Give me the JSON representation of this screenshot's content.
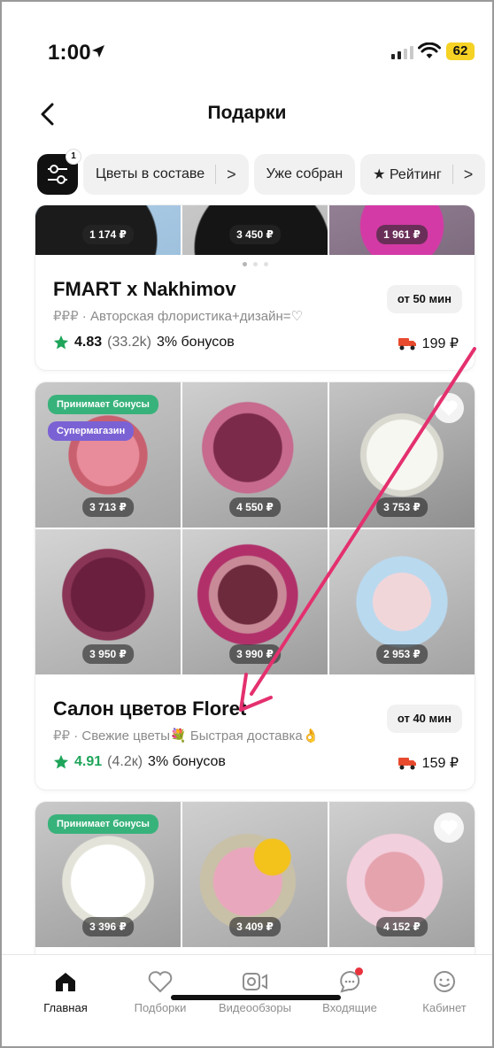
{
  "status_bar": {
    "time": "1:00",
    "battery": "62"
  },
  "header": {
    "title": "Подарки",
    "back_icon": "chevron-left-icon"
  },
  "filters": {
    "count_badge": "1",
    "chips": [
      {
        "label": "Цветы в составе",
        "suffix": ">"
      },
      {
        "label": "Уже собран"
      },
      {
        "label": "★ Рейтинг",
        "suffix": ">"
      }
    ]
  },
  "stores": [
    {
      "name": "FMART x Nakhimov",
      "price_level": "₽₽₽",
      "description": " · Авторская флористика+дизайн=♡",
      "eta": "от 50 мин",
      "rating": "4.83",
      "reviews": "(33.2k)",
      "bonus": "3% бонусов",
      "delivery_fee": "199 ₽",
      "products": [
        {
          "price": "1 174 ₽"
        },
        {
          "price": "3 450 ₽"
        },
        {
          "price": "1 961 ₽"
        }
      ]
    },
    {
      "name": "Салон цветов Floret",
      "price_level": "₽₽",
      "description": " · Свежие цветы💐 Быстрая доставка👌",
      "eta": "от 40 мин",
      "rating": "4.91",
      "reviews": "(4.2к)",
      "bonus": "3% бонусов",
      "delivery_fee": "159 ₽",
      "badges": [
        "Принимает бонусы",
        "Супермагазин"
      ],
      "products": [
        {
          "price": "3 713 ₽"
        },
        {
          "price": "4 550 ₽"
        },
        {
          "price": "3 753 ₽"
        },
        {
          "price": "3 950 ₽"
        },
        {
          "price": "3 990 ₽"
        },
        {
          "price": "2 953 ₽"
        }
      ]
    },
    {
      "badges": [
        "Принимает бонусы"
      ],
      "products": [
        {
          "price": "3 396 ₽"
        },
        {
          "price": "3 409 ₽"
        },
        {
          "price": "4 152 ₽"
        }
      ]
    }
  ],
  "tabbar": {
    "tabs": [
      {
        "label": "Главная",
        "icon": "home-icon",
        "active": true
      },
      {
        "label": "Подборки",
        "icon": "heart-icon"
      },
      {
        "label": "Видеообзоры",
        "icon": "video-icon"
      },
      {
        "label": "Входящие",
        "icon": "chat-icon"
      },
      {
        "label": "Кабинет",
        "icon": "profile-icon"
      }
    ]
  },
  "colors": {
    "accent_green": "#1fa55a",
    "bonus_badge": "#38b27b",
    "super_badge": "#7b62d4",
    "annotation_arrow": "#e4306f",
    "battery": "#f5d224"
  }
}
